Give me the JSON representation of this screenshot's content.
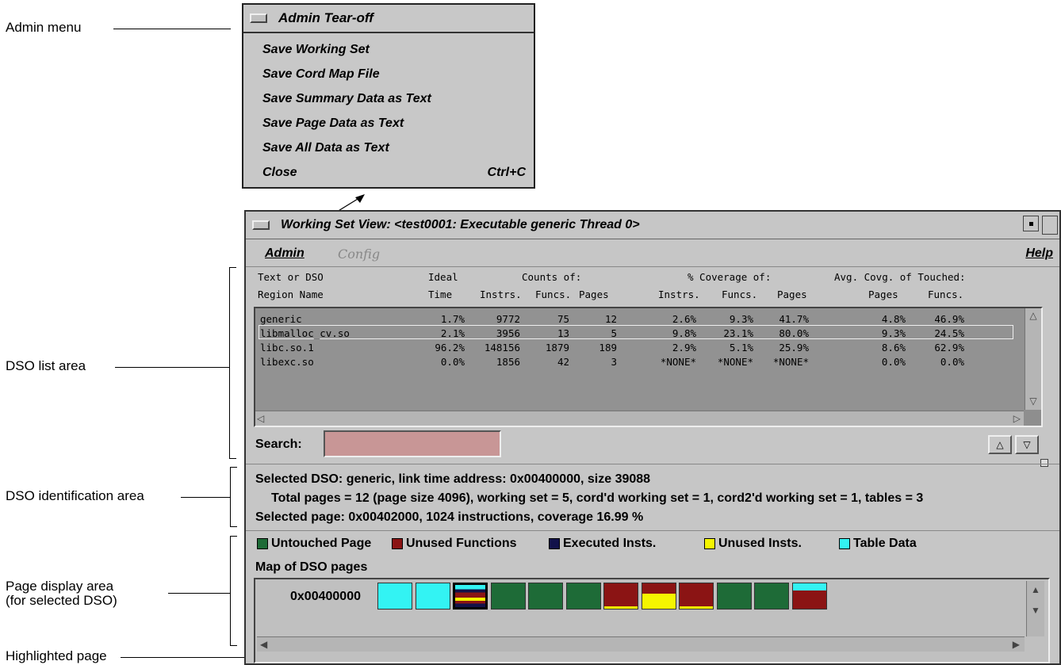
{
  "callouts": {
    "admin_menu": "Admin menu",
    "dso_list_area": "DSO list area",
    "dso_id_area": "DSO identification area",
    "page_display_line1": "Page display area",
    "page_display_line2": "(for selected DSO)",
    "highlighted_page": "Highlighted page"
  },
  "tearoff": {
    "title": "Admin Tear-off",
    "items": [
      {
        "label": "Save Working Set"
      },
      {
        "label": "Save Cord Map File"
      },
      {
        "label": "Save Summary Data as Text"
      },
      {
        "label": "Save Page Data as Text"
      },
      {
        "label": "Save All Data as Text"
      },
      {
        "label": "Close",
        "shortcut": "Ctrl+C"
      }
    ]
  },
  "window": {
    "title": "Working Set View: <test0001: Executable generic Thread 0>",
    "menus": {
      "admin": "Admin",
      "config": "Config",
      "help": "Help"
    }
  },
  "table": {
    "header1": {
      "text_or_dso": "Text or DSO",
      "ideal": "Ideal",
      "counts_of": "Counts of:",
      "coverage_of": "% Coverage of:",
      "avg_covg": "Avg. Covg. of Touched:"
    },
    "header2": {
      "region_name": "Region Name",
      "time": "Time",
      "instrs": "Instrs.",
      "funcs": "Funcs.",
      "pages": "Pages",
      "cov_instrs": "Instrs.",
      "cov_funcs": "Funcs.",
      "cov_pages": "Pages",
      "avg_pages": "Pages",
      "avg_funcs": "Funcs."
    },
    "rows": [
      {
        "name": "generic",
        "time": "1.7%",
        "instrs": "9772",
        "funcs": "75",
        "pages": "12",
        "ci": "2.6%",
        "cf": "9.3%",
        "cp": "41.7%",
        "ap": "4.8%",
        "af": "46.9%"
      },
      {
        "name": "libmalloc_cv.so",
        "time": "2.1%",
        "instrs": "3956",
        "funcs": "13",
        "pages": "5",
        "ci": "9.8%",
        "cf": "23.1%",
        "cp": "80.0%",
        "ap": "9.3%",
        "af": "24.5%"
      },
      {
        "name": "libc.so.1",
        "time": "96.2%",
        "instrs": "148156",
        "funcs": "1879",
        "pages": "189",
        "ci": "2.9%",
        "cf": "5.1%",
        "cp": "25.9%",
        "ap": "8.6%",
        "af": "62.9%"
      },
      {
        "name": "libexc.so",
        "time": "0.0%",
        "instrs": "1856",
        "funcs": "42",
        "pages": "3",
        "ci": "*NONE*",
        "cf": "*NONE*",
        "cp": "*NONE*",
        "ap": "0.0%",
        "af": "0.0%"
      }
    ]
  },
  "search": {
    "label": "Search:",
    "value": ""
  },
  "info": {
    "selected_dso": "Selected DSO: generic, link time address: 0x00400000, size 39088",
    "totals": "Total pages = 12 (page size 4096), working set = 5, cord'd working set = 1, cord2'd working set = 1, tables = 3",
    "selected_page": "Selected page: 0x00402000,   1024 instructions, coverage 16.99 %"
  },
  "legend": [
    {
      "label": "Untouched Page",
      "color": "#1e6b37"
    },
    {
      "label": "Unused Functions",
      "color": "#8b1414"
    },
    {
      "label": "Executed Insts.",
      "color": "#12124a"
    },
    {
      "label": "Unused Insts.",
      "color": "#f5f500"
    },
    {
      "label": "Table Data",
      "color": "#33f3f3"
    }
  ],
  "map": {
    "title": "Map of DSO pages",
    "address": "0x00400000",
    "pages": [
      "table",
      "table",
      "highlighted",
      "untouched",
      "untouched",
      "untouched",
      "unused-func",
      "mixed-yellow",
      "unused-func",
      "untouched",
      "untouched",
      "table-top"
    ]
  },
  "colors": {
    "untouched": "#1e6b37",
    "unused_func": "#8b1414",
    "executed": "#12124a",
    "unused_inst": "#f5f500",
    "table": "#33f3f3",
    "search_bg": "#c89696"
  }
}
